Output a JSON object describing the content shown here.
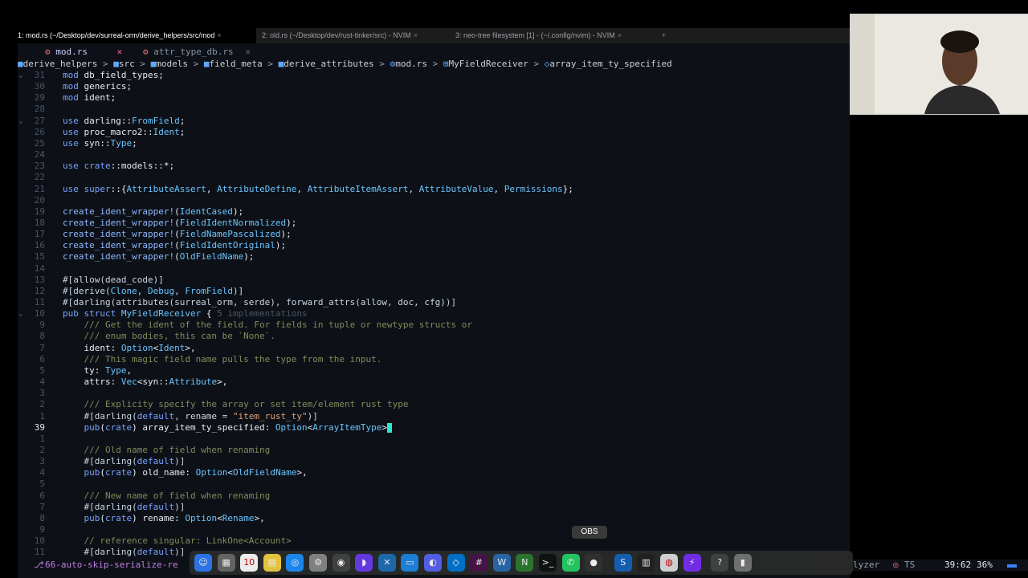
{
  "terminal_tabs": [
    {
      "label": "1: mod.rs (~/Desktop/dev/surreal-orm/derive_helpers/src/mod",
      "active": true
    },
    {
      "label": "2: old.rs (~/Desktop/dev/rust-tinker/src) - NVIM",
      "active": false
    },
    {
      "label": "3: neo-tree filesystem [1] - (~/.config/nvim) - NVIM",
      "active": false
    }
  ],
  "tab_close_glyph": "×",
  "tab_plus_glyph": "+",
  "buffers": [
    {
      "name": "mod.rs",
      "active": true
    },
    {
      "name": "attr_type_db.rs",
      "active": false
    }
  ],
  "buffer_close_glyph": "✕",
  "breadcrumb": {
    "sep": ">",
    "items": [
      "derive_helpers",
      "src",
      "models",
      "field_meta",
      "derive_attributes",
      "mod.rs",
      "MyFieldReceiver",
      "array_item_ty_specified"
    ]
  },
  "cursor_line_number": "39",
  "lines": [
    {
      "n": "31",
      "f": "⌄",
      "tok": [
        [
          "k",
          "mod "
        ],
        [
          "",
          "db_field_types;"
        ]
      ]
    },
    {
      "n": "30",
      "tok": [
        [
          "k",
          "mod "
        ],
        [
          "",
          "generics;"
        ]
      ]
    },
    {
      "n": "29",
      "tok": [
        [
          "k",
          "mod "
        ],
        [
          "",
          "ident;"
        ]
      ]
    },
    {
      "n": "28",
      "tok": []
    },
    {
      "n": "27",
      "f": "⌄",
      "tok": [
        [
          "k",
          "use "
        ],
        [
          "",
          "darling::"
        ],
        [
          "t",
          "FromField"
        ],
        [
          "",
          "; "
        ]
      ]
    },
    {
      "n": "26",
      "tok": [
        [
          "k",
          "use "
        ],
        [
          "",
          "proc_macro2::"
        ],
        [
          "t",
          "Ident"
        ],
        [
          "",
          ";"
        ]
      ]
    },
    {
      "n": "25",
      "tok": [
        [
          "k",
          "use "
        ],
        [
          "",
          "syn::"
        ],
        [
          "t",
          "Type"
        ],
        [
          "",
          ";"
        ]
      ]
    },
    {
      "n": "24",
      "tok": []
    },
    {
      "n": "23",
      "tok": [
        [
          "k",
          "use "
        ],
        [
          "k",
          "crate"
        ],
        [
          "",
          "::models::*;"
        ]
      ]
    },
    {
      "n": "22",
      "tok": []
    },
    {
      "n": "21",
      "tok": [
        [
          "k",
          "use "
        ],
        [
          "k",
          "super"
        ],
        [
          "",
          "::{"
        ],
        [
          "t",
          "AttributeAssert"
        ],
        [
          "",
          ", "
        ],
        [
          "t",
          "AttributeDefine"
        ],
        [
          "",
          ", "
        ],
        [
          "t",
          "AttributeItemAssert"
        ],
        [
          "",
          ", "
        ],
        [
          "t",
          "AttributeValue"
        ],
        [
          "",
          ", "
        ],
        [
          "t",
          "Permissions"
        ],
        [
          "",
          "};"
        ]
      ]
    },
    {
      "n": "20",
      "tok": []
    },
    {
      "n": "19",
      "tok": [
        [
          "m",
          "create_ident_wrapper!"
        ],
        [
          "",
          "("
        ],
        [
          "t",
          "IdentCased"
        ],
        [
          "",
          ");"
        ]
      ]
    },
    {
      "n": "18",
      "tok": [
        [
          "m",
          "create_ident_wrapper!"
        ],
        [
          "",
          "("
        ],
        [
          "t",
          "FieldIdentNormalized"
        ],
        [
          "",
          ");"
        ]
      ]
    },
    {
      "n": "17",
      "tok": [
        [
          "m",
          "create_ident_wrapper!"
        ],
        [
          "",
          "("
        ],
        [
          "t",
          "FieldNamePascalized"
        ],
        [
          "",
          ");"
        ]
      ]
    },
    {
      "n": "16",
      "tok": [
        [
          "m",
          "create_ident_wrapper!"
        ],
        [
          "",
          "("
        ],
        [
          "t",
          "FieldIdentOriginal"
        ],
        [
          "",
          ");"
        ]
      ]
    },
    {
      "n": "15",
      "tok": [
        [
          "m",
          "create_ident_wrapper!"
        ],
        [
          "",
          "("
        ],
        [
          "t",
          "OldFieldName"
        ],
        [
          "",
          ");"
        ]
      ]
    },
    {
      "n": "14",
      "tok": []
    },
    {
      "n": "13",
      "tok": [
        [
          "p",
          "#[allow(dead_code)]"
        ]
      ]
    },
    {
      "n": "12",
      "tok": [
        [
          "p",
          "#[derive("
        ],
        [
          "t",
          "Clone"
        ],
        [
          "p",
          ", "
        ],
        [
          "t",
          "Debug"
        ],
        [
          "p",
          ", "
        ],
        [
          "t",
          "FromField"
        ],
        [
          "p",
          ")]"
        ]
      ]
    },
    {
      "n": "11",
      "tok": [
        [
          "p",
          "#[darling(attributes(surreal_orm, serde), forward_attrs(allow, doc, cfg))]"
        ]
      ]
    },
    {
      "n": "10",
      "f": "⌄",
      "tok": [
        [
          "k",
          "pub struct "
        ],
        [
          "t",
          "MyFieldReceiver"
        ],
        [
          "",
          " { "
        ],
        [
          "h",
          "5 implementations"
        ]
      ]
    },
    {
      "n": "9",
      "tok": [
        [
          "c",
          "    /// Get the ident of the field. For fields in tuple or newtype structs or"
        ]
      ]
    },
    {
      "n": "8",
      "tok": [
        [
          "c",
          "    /// enum bodies, this can be `None`."
        ]
      ]
    },
    {
      "n": "7",
      "tok": [
        [
          "",
          "    ident: "
        ],
        [
          "t",
          "Option"
        ],
        [
          "",
          "<"
        ],
        [
          "t",
          "Ident"
        ],
        [
          "",
          ">,"
        ]
      ]
    },
    {
      "n": "6",
      "tok": [
        [
          "c",
          "    /// This magic field name pulls the type from the input."
        ]
      ]
    },
    {
      "n": "5",
      "tok": [
        [
          "",
          "    ty: "
        ],
        [
          "t",
          "Type"
        ],
        [
          "",
          ","
        ]
      ]
    },
    {
      "n": "4",
      "tok": [
        [
          "",
          "    attrs: "
        ],
        [
          "t",
          "Vec"
        ],
        [
          "",
          "<syn::"
        ],
        [
          "t",
          "Attribute"
        ],
        [
          "",
          ">,"
        ]
      ]
    },
    {
      "n": "3",
      "tok": []
    },
    {
      "n": "2",
      "tok": [
        [
          "c",
          "    /// Explicity specify the array or set item/element rust type"
        ]
      ]
    },
    {
      "n": "1",
      "tok": [
        [
          "p",
          "    #[darling("
        ],
        [
          "k",
          "default"
        ],
        [
          "p",
          ", rename = "
        ],
        [
          "s",
          "\"item_rust_ty\""
        ],
        [
          "p",
          ")]"
        ]
      ]
    },
    {
      "n": "39",
      "cur": true,
      "tok": [
        [
          "k",
          "    pub"
        ],
        [
          "",
          "("
        ],
        [
          "k",
          "crate"
        ],
        [
          "",
          ") array_item_ty_specified: "
        ],
        [
          "t",
          "Option"
        ],
        [
          "",
          "<"
        ],
        [
          "t",
          "ArrayItemType"
        ],
        [
          "",
          ">"
        ]
      ]
    },
    {
      "n": "1",
      "tok": []
    },
    {
      "n": "2",
      "tok": [
        [
          "c",
          "    /// Old name of field when renaming"
        ]
      ]
    },
    {
      "n": "3",
      "tok": [
        [
          "p",
          "    #[darling("
        ],
        [
          "k",
          "default"
        ],
        [
          "p",
          ")]"
        ]
      ]
    },
    {
      "n": "4",
      "tok": [
        [
          "k",
          "    pub"
        ],
        [
          "",
          "("
        ],
        [
          "k",
          "crate"
        ],
        [
          "",
          ") old_name: "
        ],
        [
          "t",
          "Option"
        ],
        [
          "",
          "<"
        ],
        [
          "t",
          "OldFieldName"
        ],
        [
          "",
          ">,"
        ]
      ]
    },
    {
      "n": "5",
      "tok": []
    },
    {
      "n": "6",
      "tok": [
        [
          "c",
          "    /// New name of field when renaming"
        ]
      ]
    },
    {
      "n": "7",
      "tok": [
        [
          "p",
          "    #[darling("
        ],
        [
          "k",
          "default"
        ],
        [
          "p",
          ")]"
        ]
      ]
    },
    {
      "n": "8",
      "tok": [
        [
          "k",
          "    pub"
        ],
        [
          "",
          "("
        ],
        [
          "k",
          "crate"
        ],
        [
          "",
          ") rename: "
        ],
        [
          "t",
          "Option"
        ],
        [
          "",
          "<"
        ],
        [
          "t",
          "Rename"
        ],
        [
          "",
          ">,"
        ]
      ]
    },
    {
      "n": "9",
      "tok": []
    },
    {
      "n": "10",
      "tok": [
        [
          "c",
          "    // reference singular: LinkOne<Account>"
        ]
      ]
    },
    {
      "n": "11",
      "tok": [
        [
          "p",
          "    #[darling("
        ],
        [
          "k",
          "default"
        ],
        [
          "p",
          ")]"
        ]
      ]
    }
  ],
  "status": {
    "branch": "66-auto-skip-serialize-re",
    "right_label": "lyzer",
    "ts": "TS",
    "position": "39:62",
    "percent": "36%"
  },
  "dock_tooltip": "OBS",
  "dock_items": [
    "finder-icon",
    "launchpad-icon",
    "calendar-icon",
    "notes-icon",
    "safari-icon",
    "settings-icon",
    "app-icon",
    "arc-icon",
    "xcode-icon",
    "screen-icon",
    "discord-icon",
    "vscode-icon",
    "slack-icon",
    "sw-icon",
    "neovim-icon",
    "terminal-icon",
    "whatsapp-icon",
    "obs-icon",
    "sourcetree-icon",
    "activity-icon",
    "chrome-icon",
    "bolt-icon",
    "help-icon",
    "trash-icon"
  ],
  "colors": {
    "accent": "#2ee6c8",
    "keyword": "#7aa2ff",
    "type": "#6bc4ff",
    "string": "#e0a07a",
    "comment": "#7f8c5a"
  }
}
